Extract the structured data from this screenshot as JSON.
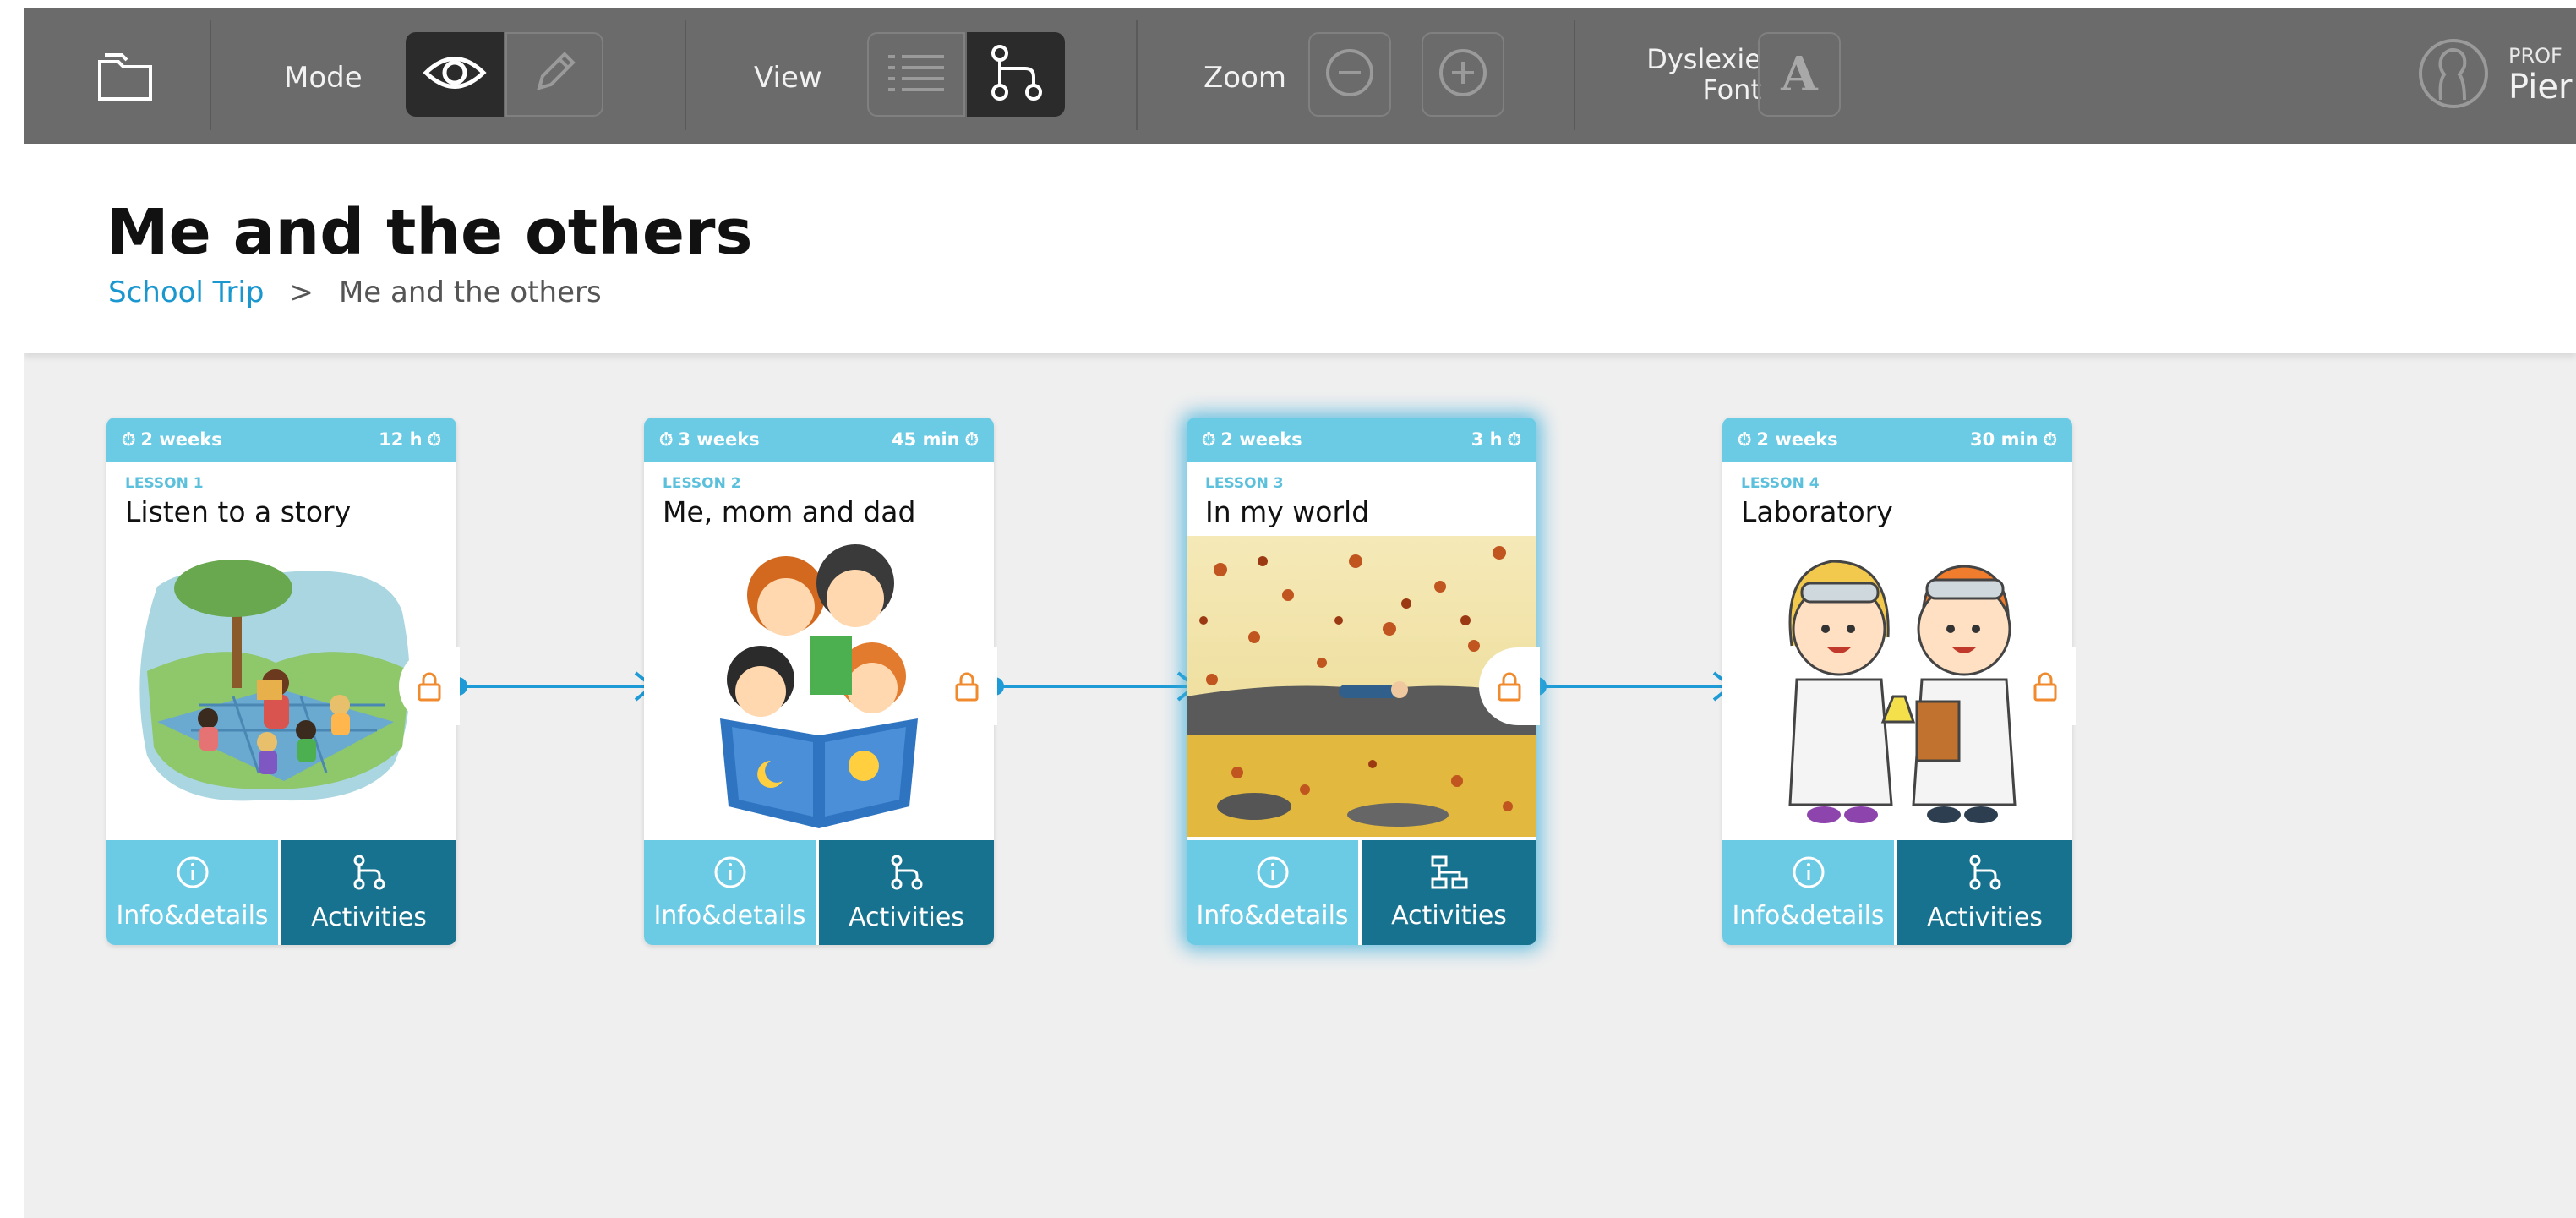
{
  "toolbar": {
    "mode_label": "Mode",
    "view_label": "View",
    "zoom_label": "Zoom",
    "dyslexie_line1": "Dyslexie",
    "dyslexie_line2": "Font",
    "font_button_glyph": "A",
    "profile_role": "PROF",
    "profile_name": "Pier"
  },
  "header": {
    "title": "Me and the others",
    "breadcrumb": {
      "parent": "School Trip",
      "separator": ">",
      "current": "Me and the others"
    }
  },
  "lessons": [
    {
      "duration": "2 weeks",
      "time": "12 h",
      "tag": "LESSON 1",
      "name": "Listen to a story",
      "info_label": "Info&details",
      "activities_label": "Activities",
      "selected": false
    },
    {
      "duration": "3 weeks",
      "time": "45 min",
      "tag": "LESSON 2",
      "name": "Me, mom and dad",
      "info_label": "Info&details",
      "activities_label": "Activities",
      "selected": false
    },
    {
      "duration": "2 weeks",
      "time": "3 h",
      "tag": "LESSON 3",
      "name": "In my world",
      "info_label": "Info&details",
      "activities_label": "Activities",
      "selected": true
    },
    {
      "duration": "2 weeks",
      "time": "30 min",
      "tag": "LESSON 4",
      "name": "Laboratory",
      "info_label": "Info&details",
      "activities_label": "Activities",
      "selected": false
    }
  ],
  "colors": {
    "toolbar_bg": "#6b6b6b",
    "card_light": "#6ccbe4",
    "card_dark": "#17728f",
    "connector": "#1e9bd6",
    "lock": "#f08a2c",
    "link": "#1a97cf"
  }
}
